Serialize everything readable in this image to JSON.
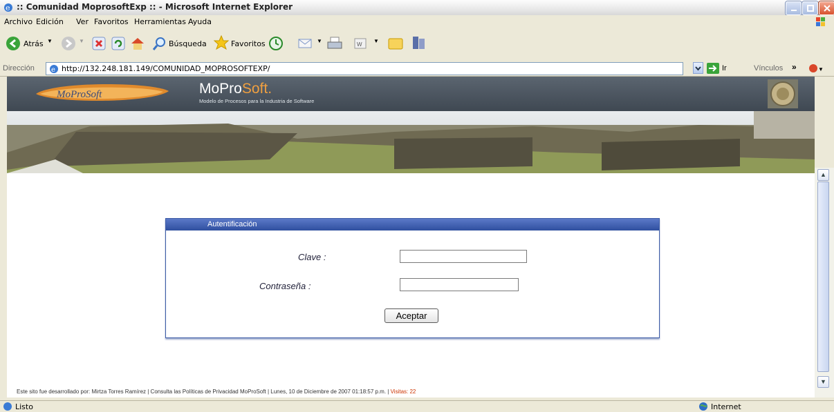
{
  "window": {
    "title": ":: Comunidad MoprosoftExp :: - Microsoft Internet Explorer"
  },
  "menu": [
    "Archivo",
    "Edición",
    "Ver",
    "Favoritos",
    "Herramientas",
    "Ayuda"
  ],
  "toolbar": {
    "back_label": "Atrás",
    "search_label": "Búsqueda",
    "favorites_label": "Favoritos"
  },
  "address": {
    "label": "Dirección",
    "url": "http://132.248.181.149/COMUNIDAD_MOPROSOFTEXP/",
    "go_label": "Ir",
    "links_label": "Vínculos"
  },
  "site": {
    "brand_mo": "MoPro",
    "brand_soft": "Soft.",
    "subtitle": "Modelo de Procesos para la Industria de Software",
    "logo_text": "MoProSoft"
  },
  "auth": {
    "title": "Autentificación",
    "user_label": "Clave :",
    "password_label": "Contraseña :",
    "user_value": "",
    "password_value": "",
    "submit_label": "Aceptar"
  },
  "footer": {
    "text": "Este sito fue desarrollado por: Mirtza Torres Ramírez   |   Consulta las Políticas de Privacidad MoProSoft    |   Lunes, 10 de Diciembre de 2007 01:18:57 p.m. |",
    "visits": "Visitas: 22"
  },
  "status": {
    "text": "Listo",
    "zone": "Internet"
  },
  "colors": {
    "banner": "#4a535d",
    "auth_header": "#3b5aa5",
    "visits": "#cc3300"
  }
}
